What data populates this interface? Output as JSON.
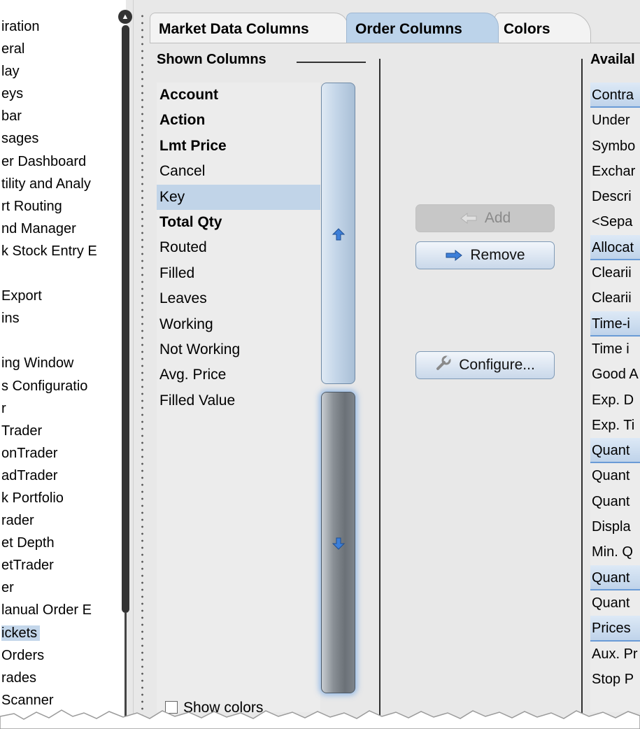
{
  "left_nav": {
    "items": [
      {
        "label": "iration",
        "selected": false
      },
      {
        "label": "eral",
        "selected": false
      },
      {
        "label": "lay",
        "selected": false
      },
      {
        "label": "eys",
        "selected": false
      },
      {
        "label": "bar",
        "selected": false
      },
      {
        "label": "sages",
        "selected": false
      },
      {
        "label": "er Dashboard",
        "selected": false
      },
      {
        "label": "tility and Analy",
        "selected": false
      },
      {
        "label": "rt Routing",
        "selected": false
      },
      {
        "label": "nd Manager",
        "selected": false
      },
      {
        "label": "k Stock Entry E",
        "selected": false
      },
      {
        "label": "",
        "selected": false
      },
      {
        "label": " Export",
        "selected": false
      },
      {
        "label": "ins",
        "selected": false
      },
      {
        "label": "",
        "selected": false
      },
      {
        "label": "ing Window",
        "selected": false
      },
      {
        "label": "s Configuratio",
        "selected": false
      },
      {
        "label": "r",
        "selected": false
      },
      {
        "label": "Trader",
        "selected": false
      },
      {
        "label": "onTrader",
        "selected": false
      },
      {
        "label": "adTrader",
        "selected": false
      },
      {
        "label": "k Portfolio",
        "selected": false
      },
      {
        "label": "rader",
        "selected": false
      },
      {
        "label": "et Depth",
        "selected": false
      },
      {
        "label": "etTrader",
        "selected": false
      },
      {
        "label": "er",
        "selected": false
      },
      {
        "label": "lanual Order E",
        "selected": false
      },
      {
        "label": "ickets",
        "selected": true
      },
      {
        "label": "Orders",
        "selected": false
      },
      {
        "label": "rades",
        "selected": false
      },
      {
        "label": " Scanner",
        "selected": false
      }
    ]
  },
  "tabs": {
    "market_data": "Market Data Columns",
    "order": "Order Columns",
    "colors": "Colors",
    "active": "Order Columns"
  },
  "shown_columns": {
    "title": "Shown Columns",
    "items": [
      {
        "label": "Account",
        "bold": true,
        "selected": false
      },
      {
        "label": "Action",
        "bold": true,
        "selected": false
      },
      {
        "label": "Lmt Price",
        "bold": true,
        "selected": false
      },
      {
        "label": "Cancel",
        "bold": false,
        "selected": false
      },
      {
        "label": "Key",
        "bold": false,
        "selected": true
      },
      {
        "label": "Total Qty",
        "bold": true,
        "selected": false
      },
      {
        "label": "Routed",
        "bold": false,
        "selected": false
      },
      {
        "label": "Filled",
        "bold": false,
        "selected": false
      },
      {
        "label": "Leaves",
        "bold": false,
        "selected": false
      },
      {
        "label": "Working",
        "bold": false,
        "selected": false
      },
      {
        "label": "Not Working",
        "bold": false,
        "selected": false
      },
      {
        "label": "Avg. Price",
        "bold": false,
        "selected": false
      },
      {
        "label": "Filled Value",
        "bold": false,
        "selected": false
      }
    ],
    "move_up_icon": "arrow-up-icon",
    "move_down_icon": "arrow-down-icon"
  },
  "buttons": {
    "add": "Add",
    "remove": "Remove",
    "configure": "Configure...",
    "add_enabled": false
  },
  "available_columns": {
    "title": "Availal",
    "items": [
      {
        "label": "Contra",
        "header": true
      },
      {
        "label": "Under",
        "header": false
      },
      {
        "label": "Symbo",
        "header": false
      },
      {
        "label": "Exchar",
        "header": false
      },
      {
        "label": "Descri",
        "header": false
      },
      {
        "label": "<Sepa",
        "header": false
      },
      {
        "label": "Allocat",
        "header": true
      },
      {
        "label": "Clearii",
        "header": false
      },
      {
        "label": "Clearii",
        "header": false
      },
      {
        "label": "Time-i",
        "header": true
      },
      {
        "label": "Time i",
        "header": false
      },
      {
        "label": "Good A",
        "header": false
      },
      {
        "label": "Exp. D",
        "header": false
      },
      {
        "label": "Exp. Ti",
        "header": false
      },
      {
        "label": "Quant",
        "header": true
      },
      {
        "label": "Quant",
        "header": false
      },
      {
        "label": "Quant",
        "header": false
      },
      {
        "label": "Displa",
        "header": false
      },
      {
        "label": "Min. Q",
        "header": false
      },
      {
        "label": "Quant",
        "header": true
      },
      {
        "label": "Quant",
        "header": false
      },
      {
        "label": "Prices",
        "header": true
      },
      {
        "label": "Aux. Pr",
        "header": false
      },
      {
        "label": "Stop P",
        "header": false
      }
    ]
  },
  "show_colors": {
    "label": "Show colors",
    "checked": false
  },
  "colors": {
    "selection": "#c1d4e8",
    "group_header_border": "#6a9bd6",
    "arrow_blue": "#3d7fd9"
  }
}
